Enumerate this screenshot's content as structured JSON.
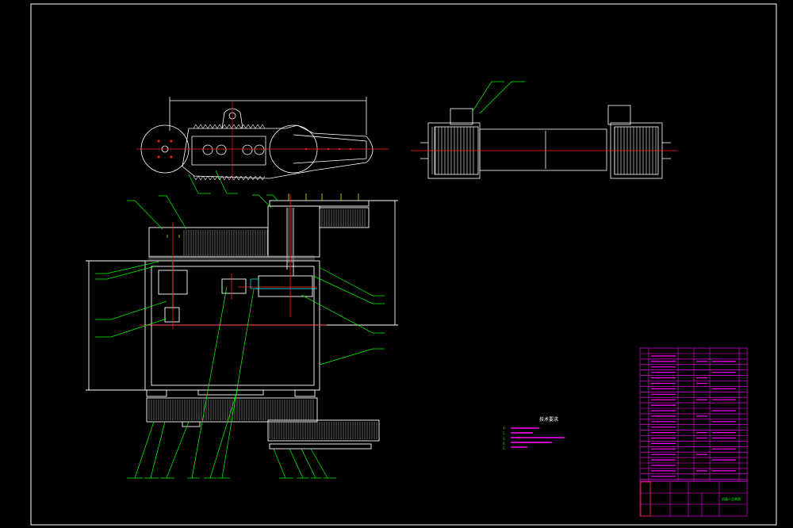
{
  "drawing": {
    "colors": {
      "background": "#000000",
      "outline": "#ffffff",
      "centerline": "#ff2020",
      "leader": "#00ff00",
      "hatch": "#c0c0c0",
      "table": "#ff00ff",
      "dimension": "#ffffff"
    },
    "tech_requirements": {
      "title": "技术要求",
      "items": [
        "1.",
        "2.",
        "3.",
        "4.",
        "5."
      ]
    },
    "title_block": {
      "drawing_name": "机器人总装图"
    }
  }
}
